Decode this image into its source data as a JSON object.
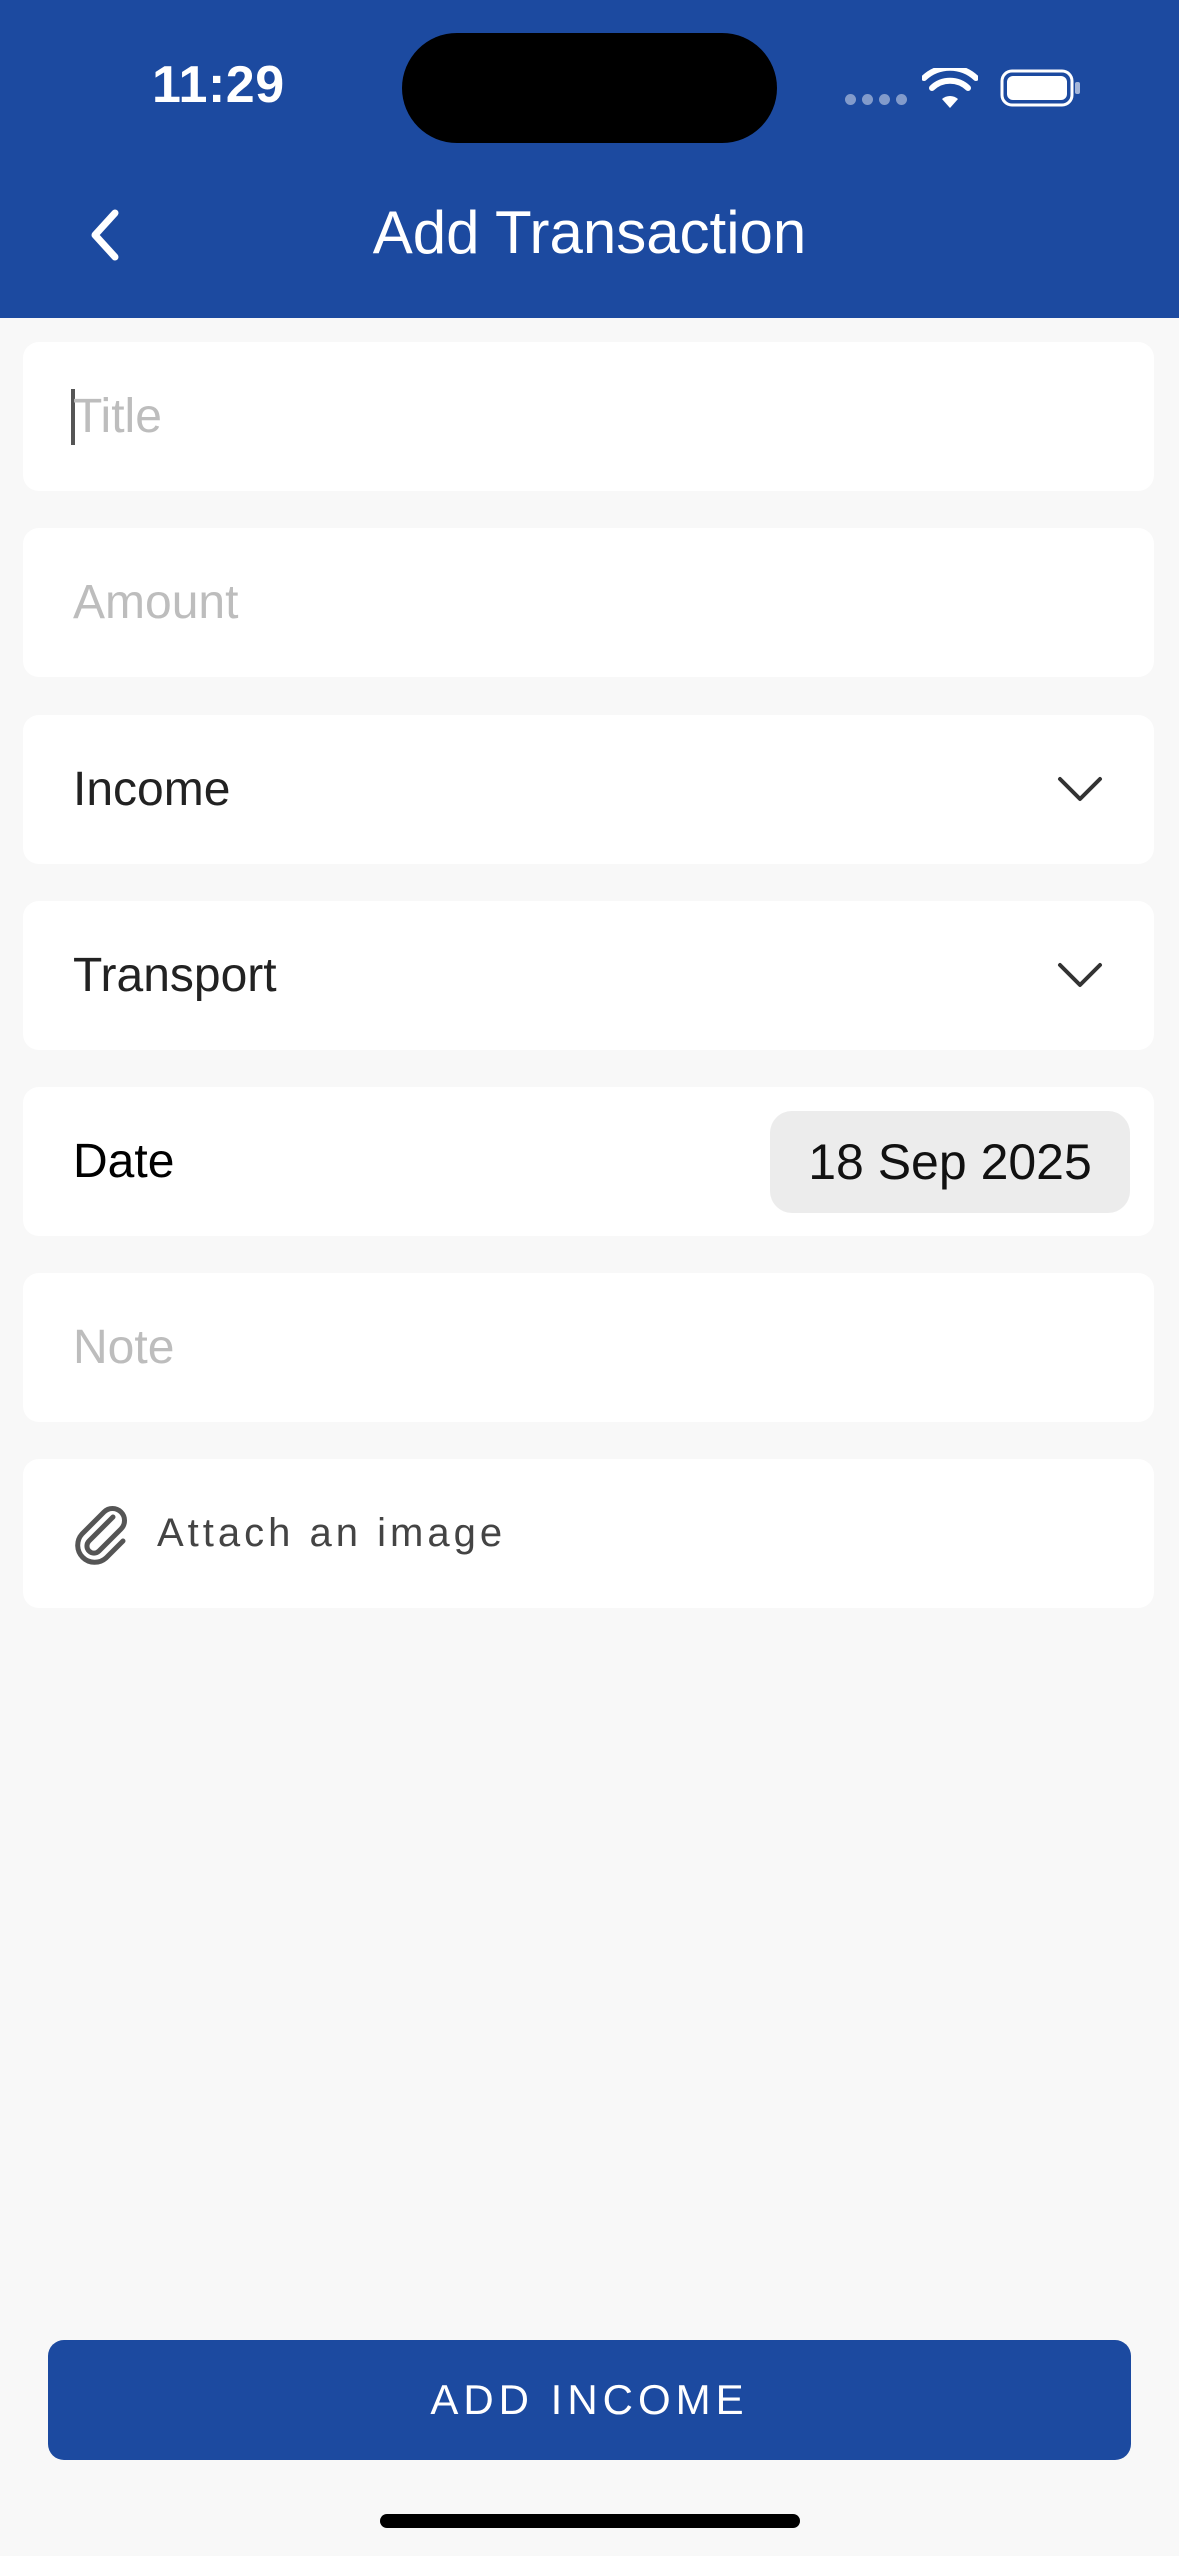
{
  "status_bar": {
    "time": "11:29"
  },
  "header": {
    "title": "Add Transaction",
    "back_icon": "chevron-left-icon",
    "color": "#1c4aa0"
  },
  "form": {
    "title_field": {
      "placeholder": "Title",
      "value": ""
    },
    "amount_field": {
      "placeholder": "Amount",
      "value": ""
    },
    "type_select": {
      "selected": "Income",
      "icon": "chevron-down-icon"
    },
    "category_select": {
      "selected": "Transport",
      "icon": "chevron-down-icon"
    },
    "date": {
      "label": "Date",
      "value": "18 Sep 2025"
    },
    "note_field": {
      "placeholder": "Note",
      "value": ""
    },
    "attachment": {
      "label": "Attach an image",
      "icon": "paperclip-icon"
    }
  },
  "actions": {
    "submit_label": "ADD INCOME"
  }
}
